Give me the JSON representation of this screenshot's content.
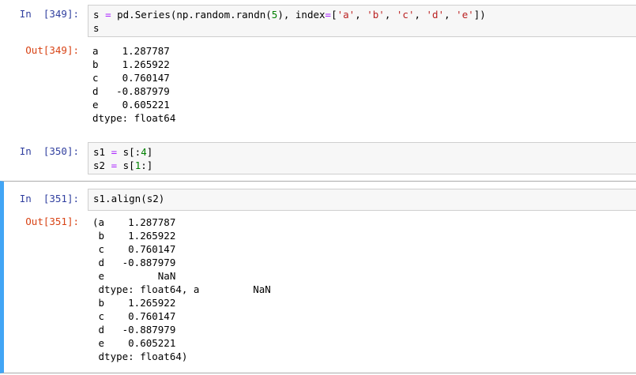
{
  "cells": [
    {
      "in_prompt": "In  [349]:",
      "code": [
        [
          {
            "t": "s "
          },
          {
            "t": "=",
            "c": "op"
          },
          {
            "t": " pd.Series(np.random.randn("
          },
          {
            "t": "5",
            "c": "num"
          },
          {
            "t": "), index"
          },
          {
            "t": "=",
            "c": "op"
          },
          {
            "t": "["
          },
          {
            "t": "'a'",
            "c": "str"
          },
          {
            "t": ", "
          },
          {
            "t": "'b'",
            "c": "str"
          },
          {
            "t": ", "
          },
          {
            "t": "'c'",
            "c": "str"
          },
          {
            "t": ", "
          },
          {
            "t": "'d'",
            "c": "str"
          },
          {
            "t": ", "
          },
          {
            "t": "'e'",
            "c": "str"
          },
          {
            "t": "])"
          }
        ],
        [
          {
            "t": "s"
          }
        ]
      ],
      "out_prompt": "Out[349]:",
      "output": [
        "a    1.287787",
        "b    1.265922",
        "c    0.760147",
        "d   -0.887979",
        "e    0.605221",
        "dtype: float64"
      ]
    },
    {
      "in_prompt": "In  [350]:",
      "code": [
        [
          {
            "t": "s1 "
          },
          {
            "t": "=",
            "c": "op"
          },
          {
            "t": " s[:"
          },
          {
            "t": "4",
            "c": "num"
          },
          {
            "t": "]"
          }
        ],
        [
          {
            "t": "s2 "
          },
          {
            "t": "=",
            "c": "op"
          },
          {
            "t": " s["
          },
          {
            "t": "1",
            "c": "num"
          },
          {
            "t": ":]"
          }
        ]
      ]
    },
    {
      "in_prompt": "In  [351]:",
      "code": [
        [
          {
            "t": "s1.align(s2)"
          }
        ]
      ],
      "out_prompt": "Out[351]:",
      "output": [
        "(a    1.287787",
        " b    1.265922",
        " c    0.760147",
        " d   -0.887979",
        " e         NaN",
        " dtype: float64, a         NaN",
        " b    1.265922",
        " c    0.760147",
        " d   -0.887979",
        " e    0.605221",
        " dtype: float64)"
      ]
    }
  ]
}
